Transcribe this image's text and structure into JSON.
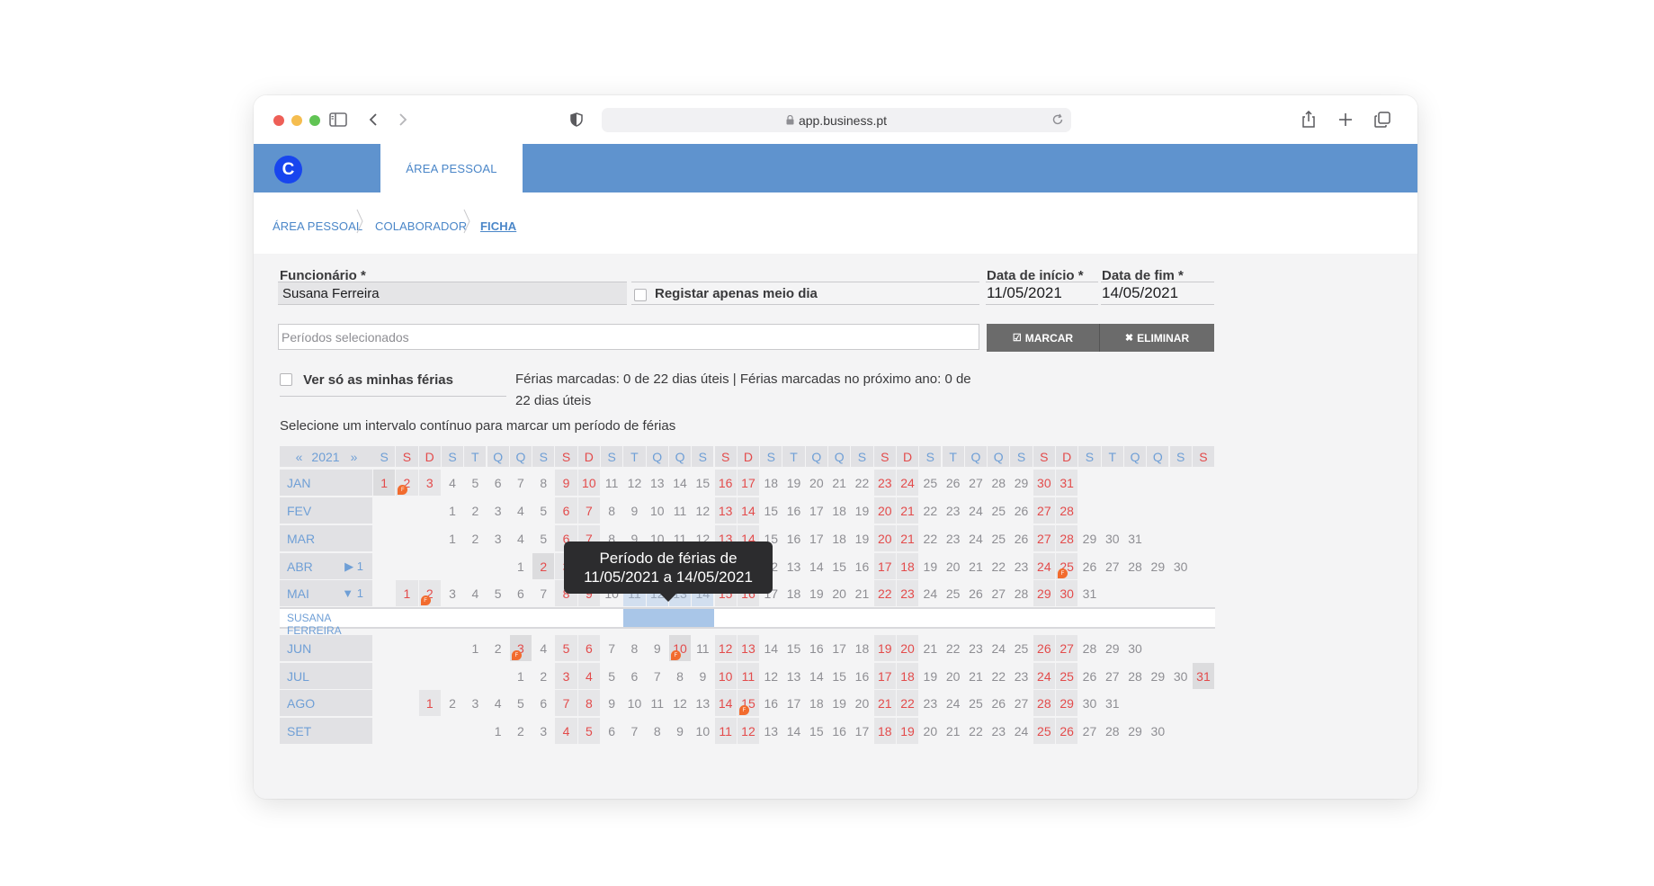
{
  "browser": {
    "url": "app.business.pt"
  },
  "app": {
    "logo_letter": "C",
    "active_tab": "ÁREA PESSOAL",
    "accent_color": "#5f93ce"
  },
  "breadcrumb": [
    "ÁREA PESSOAL",
    "COLABORADOR",
    "FICHA"
  ],
  "form": {
    "employee_label": "Funcionário *",
    "employee_value": "Susana Ferreira",
    "half_day_label": "Registar apenas meio dia",
    "start_label": "Data de início *",
    "start_value": "11/05/2021",
    "end_label": "Data de fim *",
    "end_value": "14/05/2021",
    "periods_placeholder": "Períodos selecionados",
    "mark_button": "MARCAR",
    "delete_button": "ELIMINAR",
    "only_mine_label": "Ver só as minhas férias",
    "summary": "Férias marcadas: 0 de 22 dias úteis | Férias marcadas no próximo ano: 0 de 22 dias úteis",
    "instruction": "Selecione um intervalo contínuo para marcar um período de férias"
  },
  "calendar": {
    "year": "2021",
    "prev": "«",
    "next": "»",
    "weekday_headers": [
      "S",
      "S",
      "D",
      "S",
      "T",
      "Q",
      "Q",
      "S",
      "S",
      "D",
      "S",
      "T",
      "Q",
      "Q",
      "S",
      "S",
      "D",
      "S",
      "T",
      "Q",
      "Q",
      "S",
      "S",
      "D",
      "S",
      "T",
      "Q",
      "Q",
      "S",
      "S",
      "D",
      "S",
      "T",
      "Q",
      "Q",
      "S",
      "S"
    ],
    "employee_row_label": "SUSANA FERREIRA",
    "months": [
      {
        "label": "JAN",
        "days": 31,
        "offset": 0,
        "counter": ""
      },
      {
        "label": "FEV",
        "days": 28,
        "offset": 3,
        "counter": ""
      },
      {
        "label": "MAR",
        "days": 31,
        "offset": 3,
        "counter": ""
      },
      {
        "label": "ABR",
        "days": 30,
        "offset": 6,
        "counter": "1",
        "arrow": "▶"
      },
      {
        "label": "MAI",
        "days": 31,
        "offset": 1,
        "counter": "1",
        "arrow": "▼"
      },
      {
        "label": "JUN",
        "days": 30,
        "offset": 4,
        "counter": ""
      },
      {
        "label": "JUL",
        "days": 31,
        "offset": 6,
        "counter": ""
      },
      {
        "label": "AGO",
        "days": 31,
        "offset": 2,
        "counter": ""
      },
      {
        "label": "SET",
        "days": 30,
        "offset": 5,
        "counter": ""
      }
    ],
    "holidays": {
      "JAN": [
        1
      ],
      "ABR": [
        2,
        4,
        25
      ],
      "MAI": [
        1
      ],
      "JUN": [
        3,
        10
      ],
      "AGO": [
        15
      ]
    },
    "badges": {
      "JAN": [
        2
      ],
      "ABR": [
        4,
        25
      ],
      "MAI": [
        2
      ],
      "JUN": [
        3,
        10
      ],
      "AGO": [
        15
      ]
    },
    "badge_letter": "F",
    "highlight_last_day": {
      "JUL": 31
    },
    "tooltip": [
      "Período de férias de",
      "11/05/2021 a 14/05/2021"
    ],
    "selection": {
      "month": "MAI",
      "from": 11,
      "to": 14
    },
    "selection_color": "#a9c6e8"
  }
}
